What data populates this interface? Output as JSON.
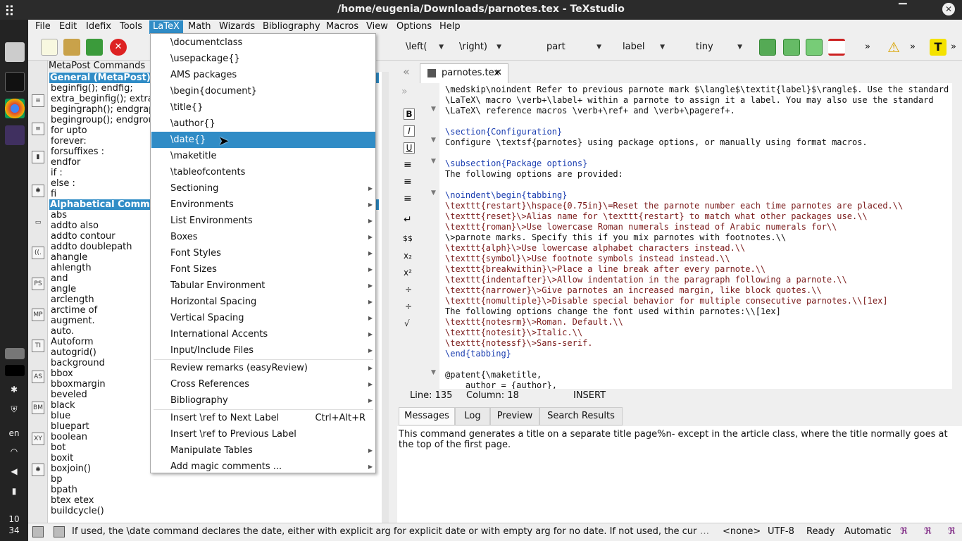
{
  "window": {
    "title": "/home/eugenia/Downloads/parnotes.tex - TeXstudio",
    "minimize": "▔",
    "close": "✕"
  },
  "dock": {
    "lang": "en",
    "time1": "10",
    "time2": "34"
  },
  "menubar": [
    "File",
    "Edit",
    "Idefix",
    "Tools",
    "LaTeX",
    "Math",
    "Wizards",
    "Bibliography",
    "Macros",
    "View",
    "Options",
    "Help"
  ],
  "toolbar": {
    "left_cmd": "\\left(",
    "right_cmd": "\\right)",
    "sectioning": "part",
    "ref": "label",
    "size": "tiny",
    "more": "»"
  },
  "sidebar_icons": [
    "MP",
    "PS",
    "TI",
    "AS",
    "BM",
    "XY"
  ],
  "command_panel": {
    "header": "MetaPost Commands",
    "group1": "General (MetaPost)",
    "group1_items": [
      "beginfig(); endfig;",
      "extra_beginfig(); extra_",
      "begingraph(); endgraph",
      "begingroup(); endgroup",
      "for  upto",
      "forever:",
      "forsuffixes :",
      "endfor",
      "if :",
      "else :",
      "fi"
    ],
    "group2": "Alphabetical Comman",
    "group2_items": [
      "abs",
      "addto also",
      "addto contour",
      "addto doublepath",
      "ahangle",
      "ahlength",
      "and",
      "angle",
      "arclength",
      "arctime of",
      "augment.",
      "auto.",
      "Autoform",
      "autogrid()",
      "background",
      "bbox",
      "bboxmargin",
      "beveled",
      "black",
      "blue",
      "bluepart",
      "boolean",
      "bot",
      "boxit",
      "boxjoin()",
      "bp",
      "bpath",
      "btex  etex",
      "buildcycle()"
    ]
  },
  "latex_menu": [
    {
      "label": "\\documentclass",
      "submenu": false
    },
    {
      "label": "\\usepackage{}",
      "submenu": false
    },
    {
      "label": "AMS packages",
      "submenu": false
    },
    {
      "label": "\\begin{document}",
      "submenu": false
    },
    {
      "label": "\\title{}",
      "submenu": false
    },
    {
      "label": "\\author{}",
      "submenu": false
    },
    {
      "label": "\\date{}",
      "submenu": false,
      "highlighted": true
    },
    {
      "label": "\\maketitle",
      "submenu": false
    },
    {
      "label": "\\tableofcontents",
      "submenu": false
    },
    {
      "label": "Sectioning",
      "submenu": true
    },
    {
      "label": "Environments",
      "submenu": true
    },
    {
      "label": "List Environments",
      "submenu": true
    },
    {
      "label": "Boxes",
      "submenu": true
    },
    {
      "label": "Font Styles",
      "submenu": true
    },
    {
      "label": "Font Sizes",
      "submenu": true
    },
    {
      "label": "Tabular Environment",
      "submenu": true
    },
    {
      "label": "Horizontal Spacing",
      "submenu": true
    },
    {
      "label": "Vertical Spacing",
      "submenu": true
    },
    {
      "label": "International Accents",
      "submenu": true
    },
    {
      "label": "Input/Include Files",
      "submenu": true
    },
    {
      "label": "Review remarks (easyReview)",
      "submenu": true
    },
    {
      "label": "Cross References",
      "submenu": true
    },
    {
      "label": "Bibliography",
      "submenu": true
    },
    {
      "label": "Insert \\ref to Next Label",
      "submenu": false,
      "shortcut": "Ctrl+Alt+R"
    },
    {
      "label": "Insert \\ref to Previous Label",
      "submenu": false
    },
    {
      "label": "Manipulate Tables",
      "submenu": true
    },
    {
      "label": "Add magic comments ...",
      "submenu": true
    }
  ],
  "editor": {
    "tab": "parnotes.tex",
    "lines": [
      "\\medskip\\noindent Refer to previous parnote mark $\\langle$\\textit{label}$\\rangle$. Use the standard",
      "\\LaTeX\\ macro \\verb+\\label+ within a parnote to assign it a label. You may also use the standard",
      "\\LaTeX\\ reference macros \\verb+\\ref+ and \\verb+\\pageref+.",
      "",
      "\\section{Configuration}",
      "Configure \\textsf{parnotes} using package options, or manually using format macros.",
      "",
      "\\subsection{Package options}",
      "The following options are provided:",
      "",
      "\\noindent\\begin{tabbing}",
      "\\texttt{restart}\\hspace{0.75in}\\=Reset the parnote number each time parnotes are placed.\\\\",
      "\\texttt{reset}\\>Alias name for \\texttt{restart} to match what other packages use.\\\\",
      "\\texttt{roman}\\>Use lowercase Roman numerals instead of Arabic numerals for\\\\",
      "\\>parnote marks. Specify this if you mix parnotes with footnotes.\\\\",
      "\\texttt{alph}\\>Use lowercase alphabet characters instead.\\\\",
      "\\texttt{symbol}\\>Use footnote symbols instead instead.\\\\",
      "\\texttt{breakwithin}\\>Place a line break after every parnote.\\\\",
      "\\texttt{indentafter}\\>Allow indentation in the paragraph following a parnote.\\\\",
      "\\texttt{narrower}\\>Give parnotes an increased margin, like block quotes.\\\\",
      "\\texttt{nomultiple}\\>Disable special behavior for multiple consecutive parnotes.\\\\[1ex]",
      "The following options change the font used within parnotes:\\\\[1ex]",
      "\\texttt{notesrm}\\>Roman. Default.\\\\",
      "\\texttt{notesit}\\>Italic.\\\\",
      "\\texttt{notessf}\\>Sans-serif.",
      "\\end{tabbing}",
      "",
      "@patent{\\maketitle,",
      "    author = {author},"
    ],
    "status_line": "Line: 135",
    "status_col": "Column: 18",
    "status_mode": "INSERT"
  },
  "bottom": {
    "tabs": [
      "Messages",
      "Log",
      "Preview",
      "Search Results"
    ],
    "message": "This command generates a title on a separate title page%n- except in the article class, where the title normally goes at the top of the first page."
  },
  "statusbar": {
    "text": "If used, the \\date command declares the date, either with explicit arg for explicit date or with empty arg for no date. If not used, the current date w",
    "encoding_lang": "<none>",
    "encoding": "UTF-8",
    "status": "Ready",
    "mode": "Automatic"
  },
  "colors": {
    "accent": "#308cc6",
    "keyword": "#1a3db0",
    "command": "#7a1a1a"
  }
}
